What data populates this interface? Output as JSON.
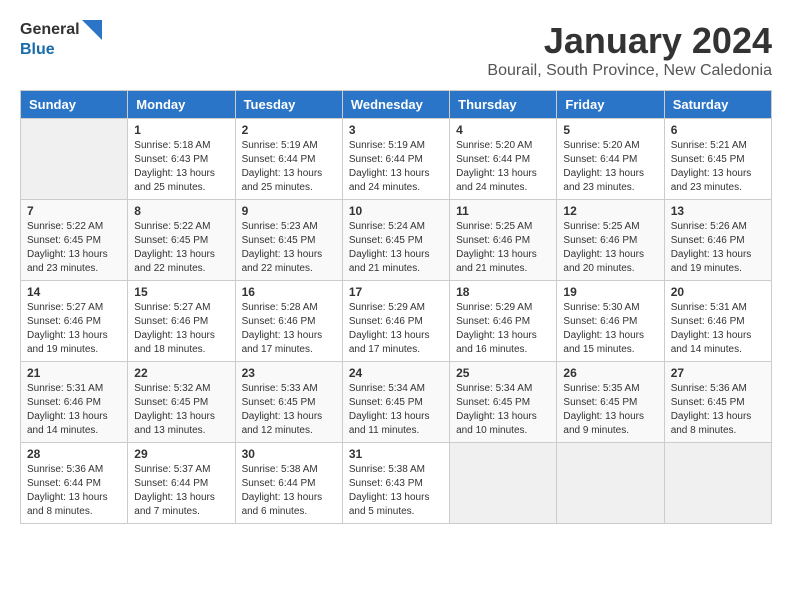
{
  "logo": {
    "general": "General",
    "blue": "Blue"
  },
  "title": "January 2024",
  "location": "Bourail, South Province, New Caledonia",
  "days_of_week": [
    "Sunday",
    "Monday",
    "Tuesday",
    "Wednesday",
    "Thursday",
    "Friday",
    "Saturday"
  ],
  "weeks": [
    [
      {
        "day": "",
        "content": ""
      },
      {
        "day": "1",
        "content": "Sunrise: 5:18 AM\nSunset: 6:43 PM\nDaylight: 13 hours\nand 25 minutes."
      },
      {
        "day": "2",
        "content": "Sunrise: 5:19 AM\nSunset: 6:44 PM\nDaylight: 13 hours\nand 25 minutes."
      },
      {
        "day": "3",
        "content": "Sunrise: 5:19 AM\nSunset: 6:44 PM\nDaylight: 13 hours\nand 24 minutes."
      },
      {
        "day": "4",
        "content": "Sunrise: 5:20 AM\nSunset: 6:44 PM\nDaylight: 13 hours\nand 24 minutes."
      },
      {
        "day": "5",
        "content": "Sunrise: 5:20 AM\nSunset: 6:44 PM\nDaylight: 13 hours\nand 23 minutes."
      },
      {
        "day": "6",
        "content": "Sunrise: 5:21 AM\nSunset: 6:45 PM\nDaylight: 13 hours\nand 23 minutes."
      }
    ],
    [
      {
        "day": "7",
        "content": "Sunrise: 5:22 AM\nSunset: 6:45 PM\nDaylight: 13 hours\nand 23 minutes."
      },
      {
        "day": "8",
        "content": "Sunrise: 5:22 AM\nSunset: 6:45 PM\nDaylight: 13 hours\nand 22 minutes."
      },
      {
        "day": "9",
        "content": "Sunrise: 5:23 AM\nSunset: 6:45 PM\nDaylight: 13 hours\nand 22 minutes."
      },
      {
        "day": "10",
        "content": "Sunrise: 5:24 AM\nSunset: 6:45 PM\nDaylight: 13 hours\nand 21 minutes."
      },
      {
        "day": "11",
        "content": "Sunrise: 5:25 AM\nSunset: 6:46 PM\nDaylight: 13 hours\nand 21 minutes."
      },
      {
        "day": "12",
        "content": "Sunrise: 5:25 AM\nSunset: 6:46 PM\nDaylight: 13 hours\nand 20 minutes."
      },
      {
        "day": "13",
        "content": "Sunrise: 5:26 AM\nSunset: 6:46 PM\nDaylight: 13 hours\nand 19 minutes."
      }
    ],
    [
      {
        "day": "14",
        "content": "Sunrise: 5:27 AM\nSunset: 6:46 PM\nDaylight: 13 hours\nand 19 minutes."
      },
      {
        "day": "15",
        "content": "Sunrise: 5:27 AM\nSunset: 6:46 PM\nDaylight: 13 hours\nand 18 minutes."
      },
      {
        "day": "16",
        "content": "Sunrise: 5:28 AM\nSunset: 6:46 PM\nDaylight: 13 hours\nand 17 minutes."
      },
      {
        "day": "17",
        "content": "Sunrise: 5:29 AM\nSunset: 6:46 PM\nDaylight: 13 hours\nand 17 minutes."
      },
      {
        "day": "18",
        "content": "Sunrise: 5:29 AM\nSunset: 6:46 PM\nDaylight: 13 hours\nand 16 minutes."
      },
      {
        "day": "19",
        "content": "Sunrise: 5:30 AM\nSunset: 6:46 PM\nDaylight: 13 hours\nand 15 minutes."
      },
      {
        "day": "20",
        "content": "Sunrise: 5:31 AM\nSunset: 6:46 PM\nDaylight: 13 hours\nand 14 minutes."
      }
    ],
    [
      {
        "day": "21",
        "content": "Sunrise: 5:31 AM\nSunset: 6:46 PM\nDaylight: 13 hours\nand 14 minutes."
      },
      {
        "day": "22",
        "content": "Sunrise: 5:32 AM\nSunset: 6:45 PM\nDaylight: 13 hours\nand 13 minutes."
      },
      {
        "day": "23",
        "content": "Sunrise: 5:33 AM\nSunset: 6:45 PM\nDaylight: 13 hours\nand 12 minutes."
      },
      {
        "day": "24",
        "content": "Sunrise: 5:34 AM\nSunset: 6:45 PM\nDaylight: 13 hours\nand 11 minutes."
      },
      {
        "day": "25",
        "content": "Sunrise: 5:34 AM\nSunset: 6:45 PM\nDaylight: 13 hours\nand 10 minutes."
      },
      {
        "day": "26",
        "content": "Sunrise: 5:35 AM\nSunset: 6:45 PM\nDaylight: 13 hours\nand 9 minutes."
      },
      {
        "day": "27",
        "content": "Sunrise: 5:36 AM\nSunset: 6:45 PM\nDaylight: 13 hours\nand 8 minutes."
      }
    ],
    [
      {
        "day": "28",
        "content": "Sunrise: 5:36 AM\nSunset: 6:44 PM\nDaylight: 13 hours\nand 8 minutes."
      },
      {
        "day": "29",
        "content": "Sunrise: 5:37 AM\nSunset: 6:44 PM\nDaylight: 13 hours\nand 7 minutes."
      },
      {
        "day": "30",
        "content": "Sunrise: 5:38 AM\nSunset: 6:44 PM\nDaylight: 13 hours\nand 6 minutes."
      },
      {
        "day": "31",
        "content": "Sunrise: 5:38 AM\nSunset: 6:43 PM\nDaylight: 13 hours\nand 5 minutes."
      },
      {
        "day": "",
        "content": ""
      },
      {
        "day": "",
        "content": ""
      },
      {
        "day": "",
        "content": ""
      }
    ]
  ]
}
